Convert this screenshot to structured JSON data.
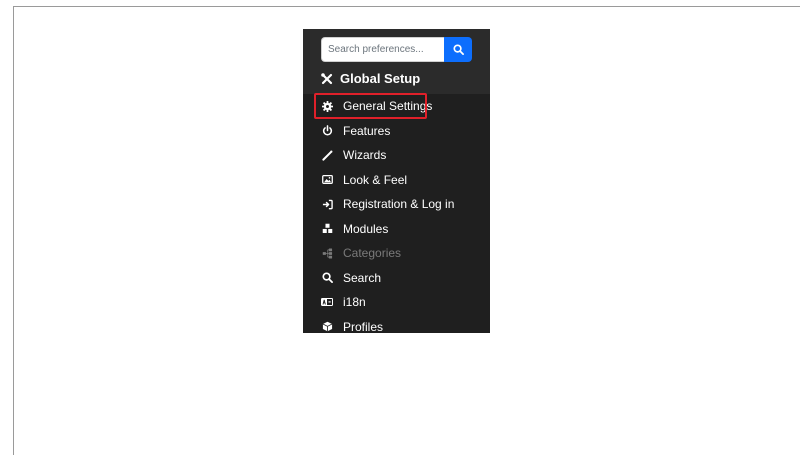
{
  "search": {
    "placeholder": "Search preferences...",
    "button_icon": "search-icon",
    "button_color": "#0d6efd"
  },
  "section": {
    "title": "Global Setup",
    "icon": "tools-icon"
  },
  "menu": {
    "items": [
      {
        "label": "General Settings",
        "icon": "gear-icon",
        "highlighted": true
      },
      {
        "label": "Features",
        "icon": "power-icon"
      },
      {
        "label": "Wizards",
        "icon": "wand-icon"
      },
      {
        "label": "Look & Feel",
        "icon": "image-icon"
      },
      {
        "label": "Registration & Log in",
        "icon": "sign-in-icon"
      },
      {
        "label": "Modules",
        "icon": "cubes-icon"
      },
      {
        "label": "Categories",
        "icon": "sitemap-icon",
        "disabled": true
      },
      {
        "label": "Search",
        "icon": "search-icon"
      },
      {
        "label": "i18n",
        "icon": "language-icon"
      },
      {
        "label": "Profiles",
        "icon": "cube-icon"
      }
    ]
  },
  "colors": {
    "panel_background": "#1f1f1f",
    "header_background": "#2b2b2b",
    "highlight_border": "#e0202a",
    "disabled_text": "#7a7a7a"
  }
}
